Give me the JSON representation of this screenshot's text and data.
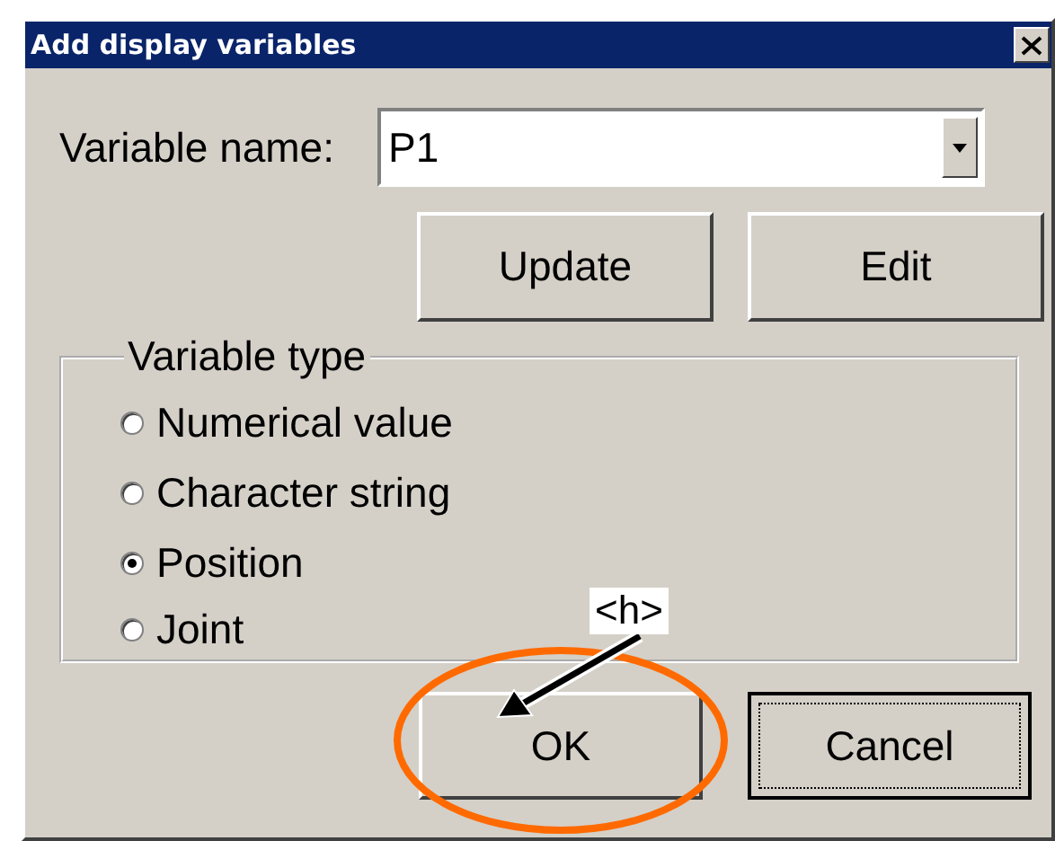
{
  "window": {
    "title": "Add display variables"
  },
  "variable_name": {
    "label": "Variable name:",
    "value": "P1"
  },
  "action_buttons": [
    {
      "label": "Update"
    },
    {
      "label": "Edit"
    }
  ],
  "variable_type": {
    "title": "Variable type",
    "options": [
      {
        "label": "Numerical value",
        "selected": false
      },
      {
        "label": "Character string",
        "selected": false
      },
      {
        "label": "Position",
        "selected": true
      },
      {
        "label": "Joint",
        "selected": false
      }
    ]
  },
  "dialog_buttons": [
    {
      "label": "OK",
      "focused": false
    },
    {
      "label": "Cancel",
      "focused": true
    }
  ],
  "annotation": {
    "label": "<h>"
  }
}
